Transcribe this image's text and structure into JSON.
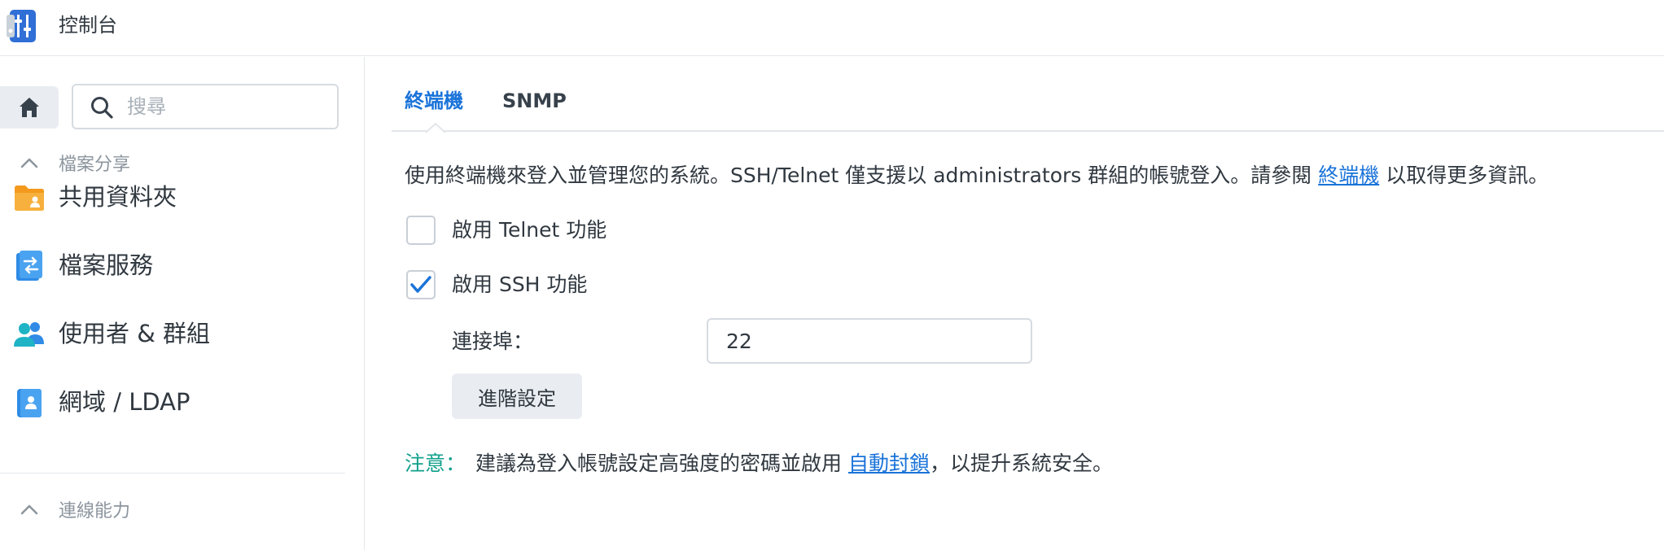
{
  "window": {
    "title": "控制台",
    "icon": "control-panel-icon"
  },
  "sidebar": {
    "home_icon": "home-icon",
    "search": {
      "placeholder": "搜尋",
      "value": ""
    },
    "groups": [
      {
        "label": "檔案分享",
        "expanded": true,
        "items": [
          {
            "label": "共用資料夾",
            "icon": "shared-folder-icon",
            "color": "#f39a1e"
          },
          {
            "label": "檔案服務",
            "icon": "file-services-icon",
            "color": "#2f8be6"
          },
          {
            "label": "使用者 & 群組",
            "icon": "users-groups-icon",
            "color": "#1fb3c6"
          },
          {
            "label": "網域 / LDAP",
            "icon": "domain-ldap-icon",
            "color": "#2f8be6"
          }
        ]
      },
      {
        "label": "連線能力",
        "expanded": true,
        "items": []
      }
    ]
  },
  "main": {
    "tabs": [
      {
        "label": "終端機",
        "active": true
      },
      {
        "label": "SNMP",
        "active": false
      }
    ],
    "description": {
      "before": "使用終端機來登入並管理您的系統。SSH/Telnet 僅支援以 administrators 群組的帳號登入。請參閱 ",
      "link": "終端機",
      "after": " 以取得更多資訊。"
    },
    "telnet": {
      "label": "啟用 Telnet 功能",
      "checked": false
    },
    "ssh": {
      "label": "啟用 SSH 功能",
      "checked": true
    },
    "port": {
      "label": "連接埠：",
      "value": "22"
    },
    "advanced_button": "進階設定",
    "note": {
      "tag": "注意：",
      "before": "建議為登入帳號設定高強度的密碼並啟用 ",
      "link": "自動封鎖",
      "after": "，以提升系統安全。"
    }
  },
  "colors": {
    "accent": "#1a73d9",
    "note": "#12a08c",
    "checkmark": "#1a73d9"
  }
}
